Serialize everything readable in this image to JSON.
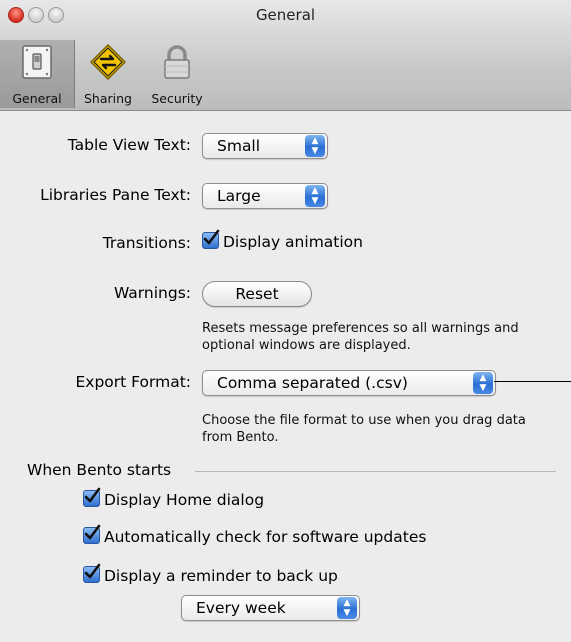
{
  "window": {
    "title": "General"
  },
  "toolbar": {
    "items": [
      {
        "label": "General",
        "icon": "general-switch-icon",
        "selected": true
      },
      {
        "label": "Sharing",
        "icon": "sharing-sign-icon",
        "selected": false
      },
      {
        "label": "Security",
        "icon": "padlock-icon",
        "selected": false
      }
    ]
  },
  "settings": {
    "table_view_text": {
      "label": "Table View Text:",
      "value": "Small"
    },
    "libraries_pane_text": {
      "label": "Libraries Pane Text:",
      "value": "Large"
    },
    "transitions": {
      "label": "Transitions:",
      "checkbox_label": "Display animation",
      "checked": true
    },
    "warnings": {
      "label": "Warnings:",
      "button_label": "Reset",
      "hint": "Resets message preferences so all warnings and optional windows are displayed."
    },
    "export_format": {
      "label": "Export Format:",
      "value": "Comma separated (.csv)",
      "hint": "Choose the file format to use when you drag data from Bento."
    }
  },
  "when_bento_starts": {
    "heading": "When Bento starts",
    "display_home": {
      "label": "Display Home dialog",
      "checked": true
    },
    "check_updates": {
      "label": "Automatically check for software updates",
      "checked": true
    },
    "backup_reminder": {
      "label": "Display a reminder to back up",
      "checked": true
    },
    "backup_frequency": {
      "value": "Every week"
    }
  },
  "colors": {
    "accent_blue": "#2a6fd4",
    "close_light": "#d8281a"
  }
}
